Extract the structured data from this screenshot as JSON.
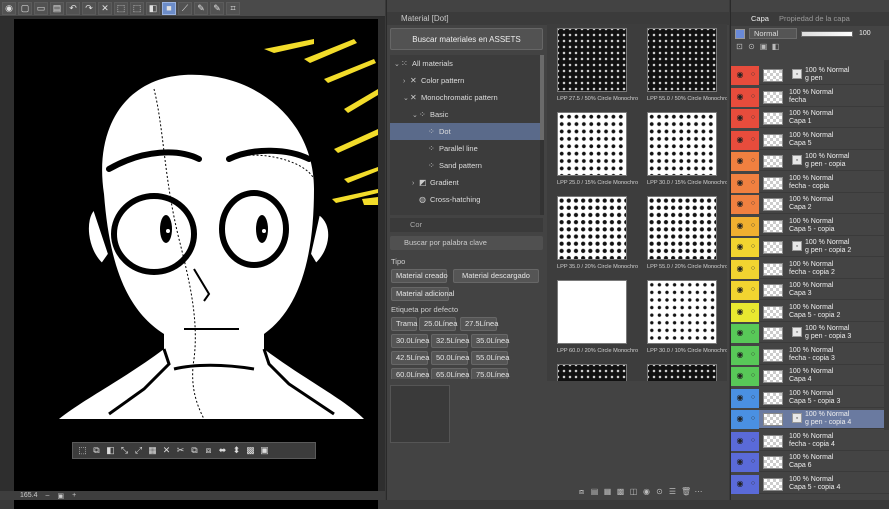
{
  "status": {
    "zoom": "165.4"
  },
  "material_panel": {
    "title": "Material [Dot]",
    "search_assets": "Buscar materiales en ASSETS",
    "tree": [
      {
        "label": "All materials",
        "icon": "grid-icon",
        "indent": 0,
        "expanded": true
      },
      {
        "label": "Color pattern",
        "icon": "color-pattern-icon",
        "indent": 1,
        "expanded": false
      },
      {
        "label": "Monochromatic pattern",
        "icon": "mono-pattern-icon",
        "indent": 1,
        "expanded": true
      },
      {
        "label": "Basic",
        "icon": "dot-icon",
        "indent": 2,
        "expanded": true
      },
      {
        "label": "Dot",
        "icon": "dot-icon",
        "indent": 3,
        "selected": true
      },
      {
        "label": "Parallel line",
        "icon": "dot-icon",
        "indent": 3
      },
      {
        "label": "Sand pattern",
        "icon": "dot-icon",
        "indent": 3
      },
      {
        "label": "Gradient",
        "icon": "gradient-icon",
        "indent": 2,
        "expanded": false
      },
      {
        "label": "Cross-hatching",
        "icon": "crosshatch-icon",
        "indent": 2
      }
    ],
    "tag_toolbar": "Cor",
    "keyword_placeholder": "Buscar por palabra clave",
    "tipo_label": "Tipo",
    "tipo_buttons": [
      "Material creado",
      "Material descargado",
      "Material adicional"
    ],
    "etiqueta_label": "Etiqueta por defecto",
    "etiqueta_buttons": [
      "Trama",
      "25.0Línea",
      "27.5Línea",
      "30.0Línea",
      "32.5Línea",
      "35.0Línea",
      "42.5Línea",
      "50.0Línea",
      "55.0Línea",
      "60.0Línea",
      "65.0Línea",
      "75.0Línea"
    ],
    "thumbnails": [
      {
        "label": "LPP 27.5 / 50% Circle Monochro",
        "density": 0.5
      },
      {
        "label": "LPP 55.0 / 50% Circle Monochro",
        "density": 0.5
      },
      {
        "label": "LPP 25.0 / 15% Circle Monochro",
        "density": 0.15
      },
      {
        "label": "LPP 30.0 / 15% Circle Monochro",
        "density": 0.15
      },
      {
        "label": "LPP 35.0 / 20% Circle Monochro",
        "density": 0.2
      },
      {
        "label": "LPP 55.0 / 20% Circle Monochro",
        "density": 0.2
      },
      {
        "label": "LPP 60.0 / 20% Circle Monochro",
        "density": 0.8
      },
      {
        "label": "LPP 30.0 / 10% Circle Monochro",
        "density": 0.1
      },
      {
        "label": "",
        "density": 0.5
      },
      {
        "label": "",
        "density": 0.5
      }
    ]
  },
  "layer_panel": {
    "tabs": [
      "Capa",
      "Propiedad de la capa"
    ],
    "blend_mode": "Normal",
    "opacity": "100",
    "layers": [
      {
        "line1": "100 % Normal",
        "line2": "g pen",
        "color": "#e74c3c",
        "sub": true
      },
      {
        "line1": "100 % Normal",
        "line2": "fecha",
        "color": "#e74c3c"
      },
      {
        "line1": "100 % Normal",
        "line2": "Capa 1",
        "color": "#e74c3c"
      },
      {
        "line1": "100 % Normal",
        "line2": "Capa 5",
        "color": "#e74c3c"
      },
      {
        "line1": "100 % Normal",
        "line2": "g pen - copia",
        "color": "#f08040",
        "sub": true
      },
      {
        "line1": "100 % Normal",
        "line2": "fecha - copia",
        "color": "#f08040"
      },
      {
        "line1": "100 % Normal",
        "line2": "Capa 2",
        "color": "#f08040"
      },
      {
        "line1": "100 % Normal",
        "line2": "Capa 5 - copia",
        "color": "#f0b030"
      },
      {
        "line1": "100 % Normal",
        "line2": "g pen - copia 2",
        "color": "#f2d430",
        "sub": true
      },
      {
        "line1": "100 % Normal",
        "line2": "fecha - copia 2",
        "color": "#f2d430"
      },
      {
        "line1": "100 % Normal",
        "line2": "Capa 3",
        "color": "#f2d430"
      },
      {
        "line1": "100 % Normal",
        "line2": "Capa 5 - copia 2",
        "color": "#e8e830"
      },
      {
        "line1": "100 % Normal",
        "line2": "g pen - copia 3",
        "color": "#58c858",
        "sub": true
      },
      {
        "line1": "100 % Normal",
        "line2": "fecha - copia 3",
        "color": "#58c858"
      },
      {
        "line1": "100 % Normal",
        "line2": "Capa 4",
        "color": "#58c858"
      },
      {
        "line1": "100 % Normal",
        "line2": "Capa 5 - copia 3",
        "color": "#4a90e2"
      },
      {
        "line1": "100 % Normal",
        "line2": "g pen - copia 4",
        "color": "#4a90e2",
        "sub": true,
        "selected": true
      },
      {
        "line1": "100 % Normal",
        "line2": "fecha - copia 4",
        "color": "#5a6ad8"
      },
      {
        "line1": "100 % Normal",
        "line2": "Capa 6",
        "color": "#5a6ad8"
      },
      {
        "line1": "100 % Normal",
        "line2": "Capa 5 - copia 4",
        "color": "#5a6ad8"
      }
    ]
  }
}
